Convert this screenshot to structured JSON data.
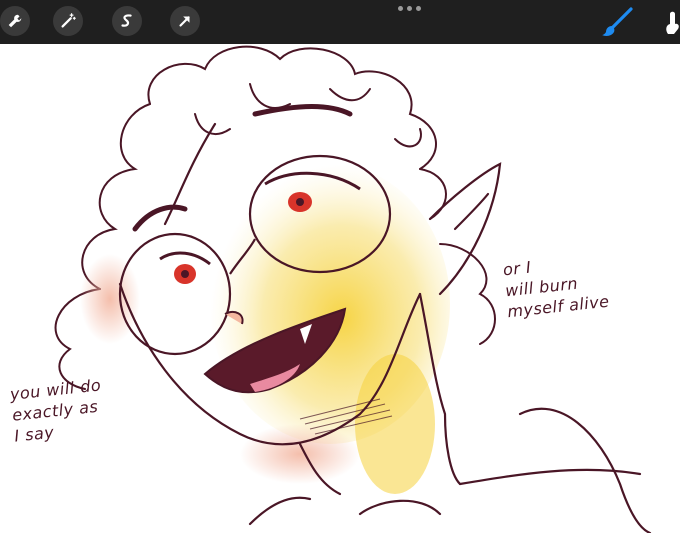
{
  "toolbar": {
    "left_tools": [
      {
        "icon": "wrench-icon",
        "name": "actions"
      },
      {
        "icon": "magic-wand-icon",
        "name": "adjustments"
      },
      {
        "icon": "selection-icon",
        "name": "selection"
      },
      {
        "icon": "arrow-cursor-icon",
        "name": "transform"
      }
    ],
    "more_icon": "ellipsis-icon",
    "brush_icon": "brush-icon",
    "smudge_icon": "smudge-icon",
    "accent": "#1e8bf0"
  },
  "canvas": {
    "notes": {
      "left": "you will do\nexactly as\nI say",
      "right": "or I\nwill burn\nmyself alive"
    },
    "colors": {
      "line": "#4a1626",
      "skin_glow": "#f7e27a",
      "blush": "#f2c9b8",
      "eye": "#d8342a"
    }
  }
}
